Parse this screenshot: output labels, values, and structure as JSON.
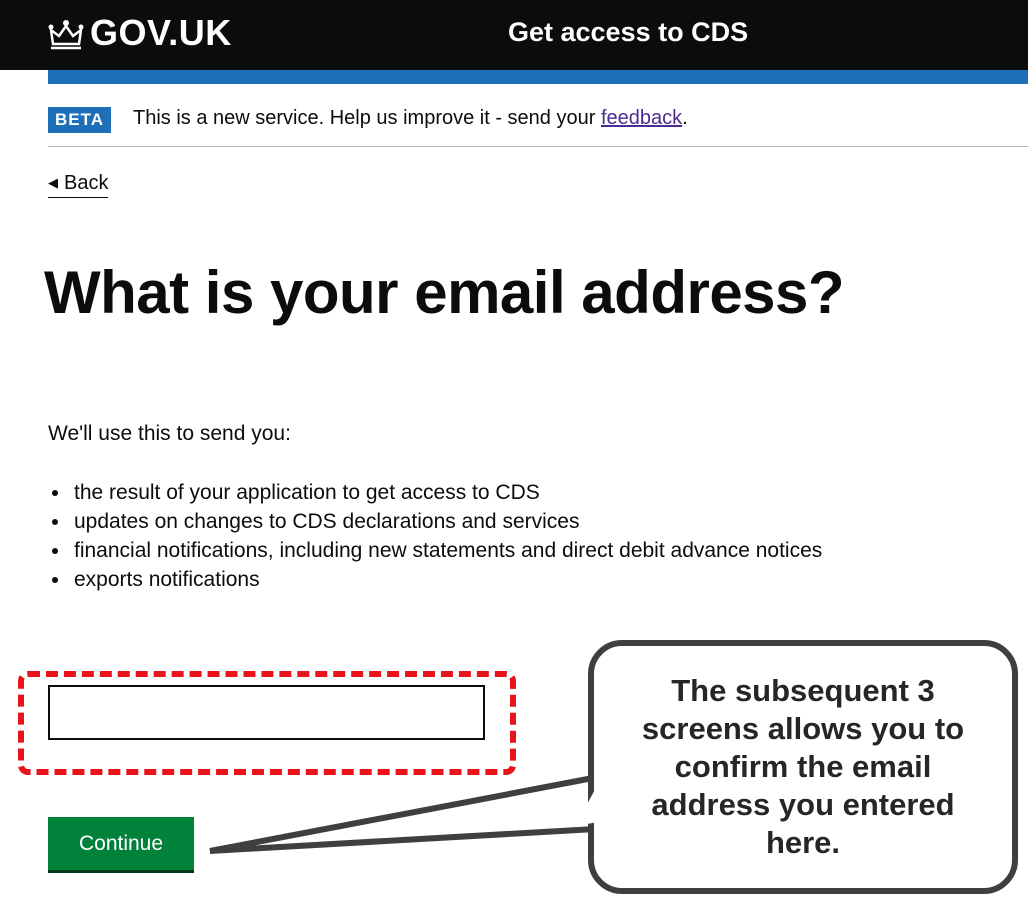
{
  "header": {
    "logo_text": "GOV.UK",
    "service_name": "Get access to CDS",
    "colors": {
      "background": "#0b0c0c",
      "stripe": "#1d70b8"
    },
    "logo_icon": "crown-icon"
  },
  "phase_banner": {
    "tag": "BETA",
    "text_before": "This is a new service. Help us improve it - send your ",
    "link_text": "feedback",
    "text_after": "."
  },
  "back_link": {
    "label": "Back",
    "icon": "chevron-left-icon"
  },
  "main": {
    "title": "What is your email address?",
    "intro": "We'll use this to send you:",
    "bullets": [
      "the result of your application to get access to CDS",
      "updates on changes to CDS declarations and services",
      "financial notifications, including new statements and direct debit advance notices",
      "exports notifications"
    ],
    "email_input": {
      "value": "",
      "placeholder": ""
    },
    "continue_label": "Continue"
  },
  "annotation": {
    "callout_text": "The subsequent 3 screens allows you to confirm the email address you entered here.",
    "highlight_color": "#e8141c"
  }
}
